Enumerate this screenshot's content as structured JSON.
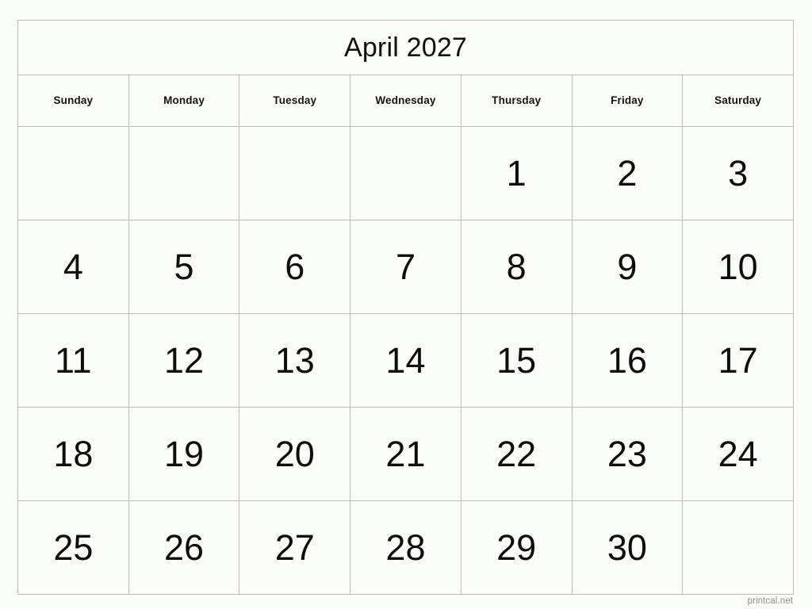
{
  "calendar": {
    "title": "April 2027",
    "weekdays": [
      "Sunday",
      "Monday",
      "Tuesday",
      "Wednesday",
      "Thursday",
      "Friday",
      "Saturday"
    ],
    "weeks": [
      [
        "",
        "",
        "",
        "",
        "1",
        "2",
        "3"
      ],
      [
        "4",
        "5",
        "6",
        "7",
        "8",
        "9",
        "10"
      ],
      [
        "11",
        "12",
        "13",
        "14",
        "15",
        "16",
        "17"
      ],
      [
        "18",
        "19",
        "20",
        "21",
        "22",
        "23",
        "24"
      ],
      [
        "25",
        "26",
        "27",
        "28",
        "29",
        "30",
        ""
      ]
    ]
  },
  "footer": {
    "watermark": "printcal.net"
  },
  "colors": {
    "page_background": "#fbfdf8",
    "cell_background": "#fbfdf8",
    "border": "#b9bdb7",
    "text": "#0d0d0d",
    "watermark_text": "#8d8d8d"
  }
}
